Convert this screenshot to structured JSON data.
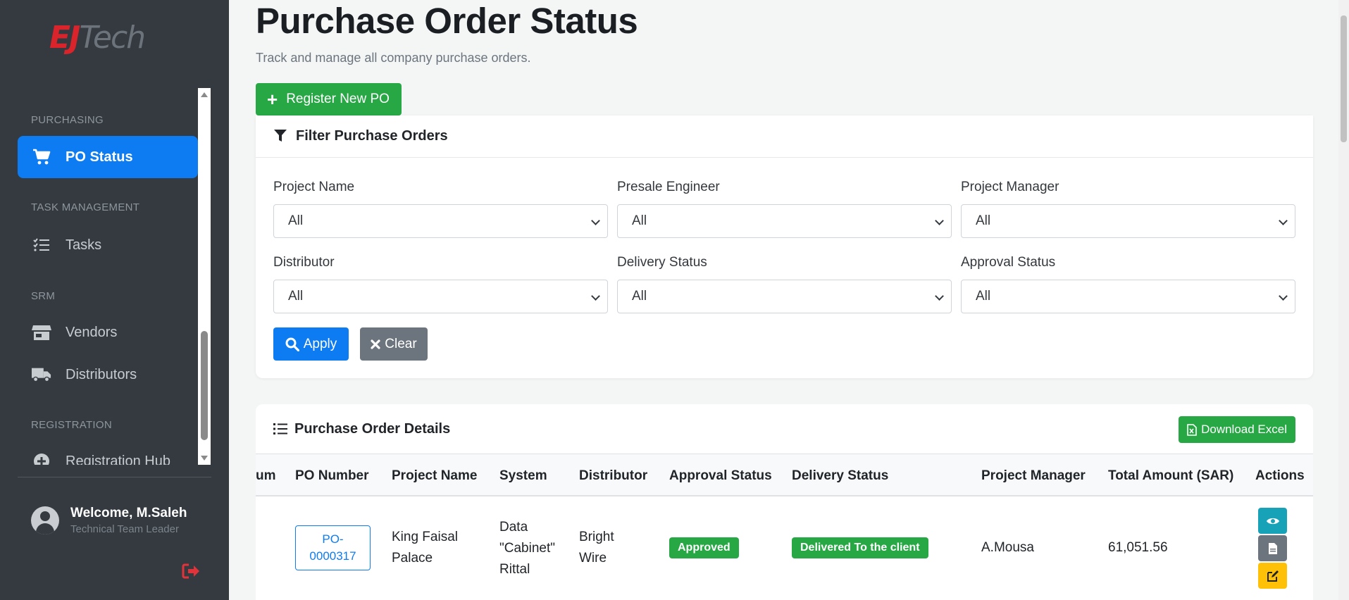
{
  "brand": {
    "logo_part1": "EJ",
    "logo_part2": "Tech"
  },
  "sidebar": {
    "sections": [
      {
        "label": "PURCHASING"
      },
      {
        "label": "TASK MANAGEMENT"
      },
      {
        "label": "SRM"
      },
      {
        "label": "REGISTRATION"
      }
    ],
    "items": [
      {
        "label": "PO Status",
        "icon": "cart-icon",
        "active": true
      },
      {
        "label": "Tasks",
        "icon": "tasks-icon"
      },
      {
        "label": "Vendors",
        "icon": "store-icon"
      },
      {
        "label": "Distributors",
        "icon": "truck-icon"
      },
      {
        "label": "Registration Hub",
        "icon": "plus-circle-icon"
      }
    ],
    "user": {
      "name": "Welcome, M.Saleh",
      "role": "Technical Team Leader"
    }
  },
  "header": {
    "title": "Purchase Order Status",
    "subtitle": "Track and manage all company purchase orders.",
    "register_label": "Register New PO"
  },
  "filters": {
    "title": "Filter Purchase Orders",
    "fields": [
      {
        "label": "Project Name",
        "value": "All"
      },
      {
        "label": "Presale Engineer",
        "value": "All"
      },
      {
        "label": "Project Manager",
        "value": "All"
      },
      {
        "label": "Distributor",
        "value": "All"
      },
      {
        "label": "Delivery Status",
        "value": "All"
      },
      {
        "label": "Approval Status",
        "value": "All"
      }
    ],
    "apply_label": "Apply",
    "clear_label": "Clear"
  },
  "table": {
    "title": "Purchase Order Details",
    "excel_label": "Download Excel",
    "columns": [
      "um",
      "PO Number",
      "Project Name",
      "System",
      "Distributor",
      "Approval Status",
      "Delivery Status",
      "Project Manager",
      "Total Amount (SAR)",
      "Actions"
    ],
    "rows": [
      {
        "po_number_line1": "PO-",
        "po_number_line2": "0000317",
        "project_name_line1": "King Faisal",
        "project_name_line2": "Palace",
        "system_line1": "Data",
        "system_line2": "\"Cabinet\"",
        "system_line3": "Rittal",
        "distributor_line1": "Bright",
        "distributor_line2": "Wire",
        "approval_status": "Approved",
        "delivery_status": "Delivered To the client",
        "project_manager": "A.Mousa",
        "total_amount": "61,051.56"
      }
    ]
  },
  "colors": {
    "sidebar_bg": "#343a40",
    "primary": "#0d7cf2",
    "success": "#28a745",
    "secondary": "#6c757d",
    "info": "#17a2b8",
    "warning": "#ffc107",
    "logout": "#e0333a"
  }
}
